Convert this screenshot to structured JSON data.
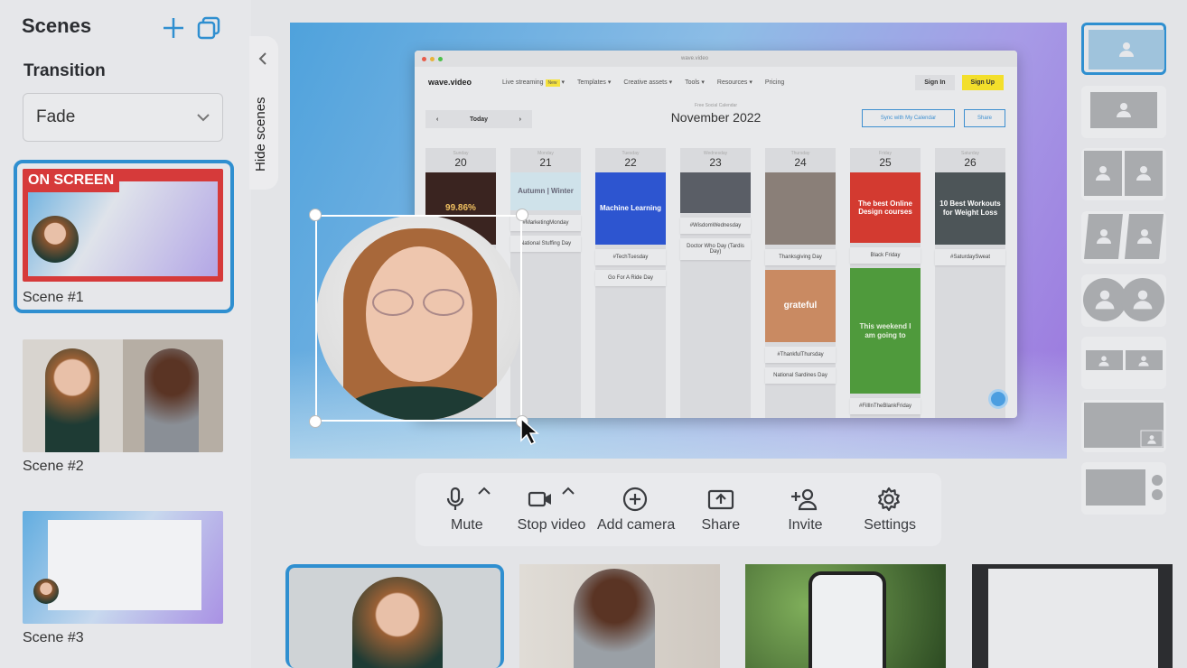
{
  "sidebar": {
    "title": "Scenes",
    "add_icon": "plus-icon",
    "duplicate_icon": "duplicate-icon",
    "transition_label": "Transition",
    "transition_value": "Fade",
    "scenes": [
      {
        "label": "Scene #1",
        "badge": "ON SCREEN",
        "selected": true
      },
      {
        "label": "Scene #2"
      },
      {
        "label": "Scene #3"
      }
    ]
  },
  "hide_scenes": "Hide scenes",
  "browser": {
    "url": "wave.video",
    "logo": "wave.video",
    "nav": [
      "Live streaming",
      "Templates",
      "Creative assets",
      "Tools",
      "Resources",
      "Pricing"
    ],
    "new_badge": "New",
    "sign_in": "Sign In",
    "sign_up": "Sign Up",
    "today": "Today",
    "subtitle": "Free Social Calendar",
    "month": "November 2022",
    "sync": "Sync with My Calendar",
    "share": "Share",
    "days": [
      {
        "name": "Sunday",
        "num": "20",
        "items": [
          {
            "type": "img",
            "text": "99.86%",
            "bg": "#3a2420",
            "color": "#f0c060",
            "h": 80
          }
        ]
      },
      {
        "name": "Monday",
        "num": "21",
        "items": [
          {
            "type": "img",
            "text": "Autumn | Winter",
            "bg": "#cfe2ea",
            "color": "#667",
            "h": 42
          },
          {
            "type": "txt",
            "text": "#MarketingMonday"
          },
          {
            "type": "txt",
            "text": "National Stuffing Day"
          }
        ]
      },
      {
        "name": "Tuesday",
        "num": "22",
        "items": [
          {
            "type": "img",
            "text": "Machine Learning",
            "bg": "#2d55d0",
            "color": "#fff",
            "h": 80
          },
          {
            "type": "txt",
            "text": "#TechTuesday"
          },
          {
            "type": "txt",
            "text": "Go For A Ride Day"
          }
        ]
      },
      {
        "name": "Wednesday",
        "num": "23",
        "items": [
          {
            "type": "img",
            "text": "",
            "bg": "#5a5e66",
            "color": "#fff",
            "h": 45
          },
          {
            "type": "txt",
            "text": "#WisdomWednesday"
          },
          {
            "type": "txt",
            "text": "Doctor Who Day (Tardis Day)"
          }
        ]
      },
      {
        "name": "Thursday",
        "num": "24",
        "items": [
          {
            "type": "img",
            "text": "",
            "bg": "#8a7f78",
            "color": "#fff",
            "h": 80
          },
          {
            "type": "txt",
            "text": "Thanksgiving Day"
          },
          {
            "type": "img",
            "text": "grateful",
            "bg": "#c98a62",
            "color": "#fff",
            "h": 80
          },
          {
            "type": "txt",
            "text": "#ThankfulThursday"
          },
          {
            "type": "txt",
            "text": "National Sardines Day"
          }
        ]
      },
      {
        "name": "Friday",
        "num": "25",
        "items": [
          {
            "type": "img",
            "text": "The best Online Design courses",
            "bg": "#d33a30",
            "color": "#fff",
            "h": 80
          },
          {
            "type": "txt",
            "text": "Black Friday"
          },
          {
            "type": "img",
            "text": "This weekend I am going to",
            "bg": "#4f9a3c",
            "color": "#e8f0e0",
            "h": 142
          },
          {
            "type": "txt",
            "text": "#FillInTheBlankFriday"
          }
        ]
      },
      {
        "name": "Saturday",
        "num": "26",
        "items": [
          {
            "type": "img",
            "text": "10 Best Workouts for Weight Loss",
            "bg": "#4d5558",
            "color": "#fff",
            "h": 80
          },
          {
            "type": "txt",
            "text": "#SaturdaySweat"
          }
        ]
      }
    ]
  },
  "controls": [
    {
      "label": "Mute",
      "icon": "microphone-icon",
      "caret": true
    },
    {
      "label": "Stop video",
      "icon": "video-camera-icon",
      "caret": true
    },
    {
      "label": "Add camera",
      "icon": "add-circle-icon"
    },
    {
      "label": "Share",
      "icon": "share-screen-icon"
    },
    {
      "label": "Invite",
      "icon": "add-person-icon"
    },
    {
      "label": "Settings",
      "icon": "gear-icon"
    }
  ],
  "layouts": [
    "single-large",
    "single",
    "side-by-side",
    "angled-split",
    "two-circles",
    "two-small",
    "screen-with-pip",
    "screen-with-side-avatars"
  ],
  "accent": "#2f8fd0"
}
